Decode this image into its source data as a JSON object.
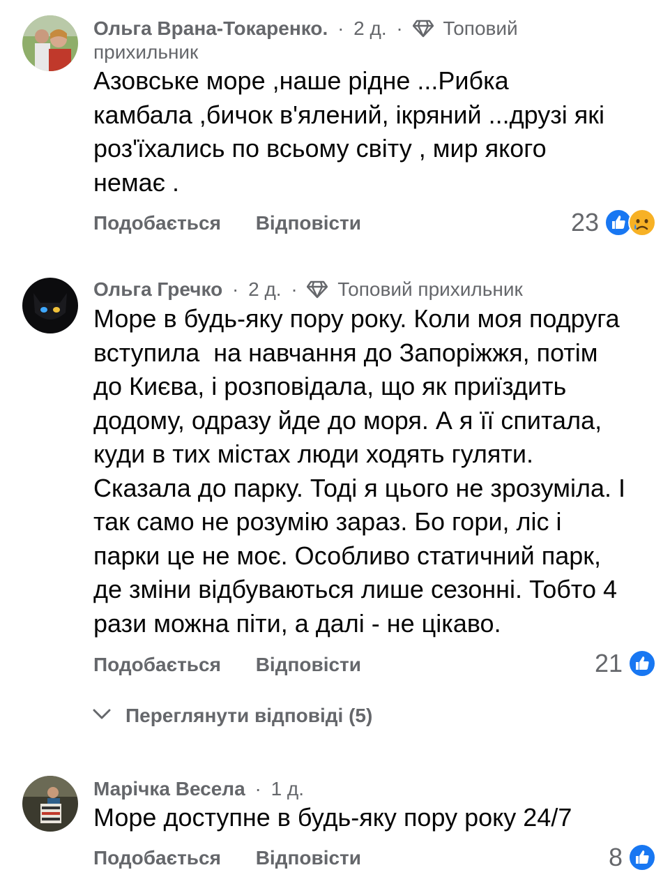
{
  "comments": [
    {
      "author": "Ольга Врана-Токаренко.",
      "time": "2 д.",
      "badge": "Топовий",
      "badge_line2": "прихильник",
      "text": "Азовське море ,наше рідне ...Рибка\nкамбала ,бичок в'ялений, ікряний ...друзі які\nроз'їхались по всьому світу , мир якого\nнемає .",
      "like_label": "Подобається",
      "reply_label": "Відповісти",
      "reaction_count": "23",
      "reactions": [
        "like-icon",
        "sad-icon"
      ]
    },
    {
      "author": "Ольга Гречко",
      "time": "2 д.",
      "badge": "Топовий прихильник",
      "text": "Море в будь-яку пору року. Коли моя подруга\nвступила  на навчання до Запоріжжя, потім\nдо Києва, і розповідала, що як приїздить\nдодому, одразу йде до моря. А я її спитала,\nкуди в тих містах люди ходять гуляти.\nСказала до парку. Тоді я цього не зрозуміла. І\nтак само не розумію зараз. Бо гори, ліс і\nпарки це не моє. Особливо статичний парк,\nде зміни відбуваються лише сезонні. Тобто 4\nрази можна піти, а далі - не цікаво.",
      "like_label": "Подобається",
      "reply_label": "Відповісти",
      "reaction_count": "21",
      "reactions": [
        "like-icon"
      ],
      "view_replies": "Переглянути відповіді (5)"
    },
    {
      "author": "Марічка Весела",
      "time": "1 д.",
      "text": "Море доступне в будь-яку пору року 24/7",
      "like_label": "Подобається",
      "reply_label": "Відповісти",
      "reaction_count": "8",
      "reactions": [
        "like-icon"
      ]
    }
  ],
  "colors": {
    "secondary_text": "#65676b",
    "primary_text": "#050505",
    "like_blue": "#1877f2",
    "sad_yellow": "#f7b125"
  }
}
